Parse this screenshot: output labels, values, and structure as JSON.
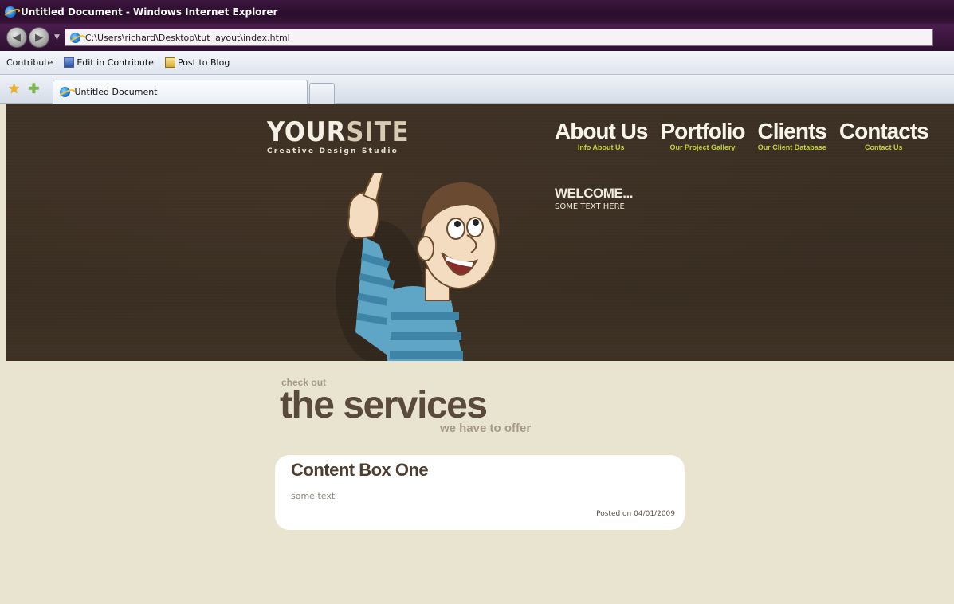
{
  "window": {
    "title": "Untitled Document - Windows Internet Explorer",
    "address": "C:\\Users\\richard\\Desktop\\tut layout\\index.html"
  },
  "toolbar": {
    "contribute_label": "Contribute",
    "edit_label": "Edit in Contribute",
    "post_label": "Post to Blog"
  },
  "tabs": [
    {
      "label": "Untitled Document"
    }
  ],
  "site": {
    "logo_primary": "YOUR",
    "logo_secondary": "SITE",
    "tagline": "Creative Design Studio",
    "nav": [
      {
        "title": "About Us",
        "subtitle": "Info About Us"
      },
      {
        "title": "Portfolio",
        "subtitle": "Our Project Gallery"
      },
      {
        "title": "Clients",
        "subtitle": "Our Client Database"
      },
      {
        "title": "Contacts",
        "subtitle": "Contact Us"
      }
    ],
    "welcome_title": "WELCOME...",
    "welcome_text": "SOME TEXT HERE"
  },
  "services": {
    "kicker_top": "check out",
    "kicker_main": "the services",
    "kicker_sub": "we have to offer"
  },
  "content_box": {
    "title": "Content Box One",
    "text": "some text",
    "posted": "Posted on 04/01/2009"
  },
  "colors": {
    "header_bg": "#3f3226",
    "content_bg": "#e9e4d0",
    "nav_sub": "#c2d23b",
    "heading_brown": "#5a4a3c",
    "chrome_purple": "#3d1640"
  }
}
